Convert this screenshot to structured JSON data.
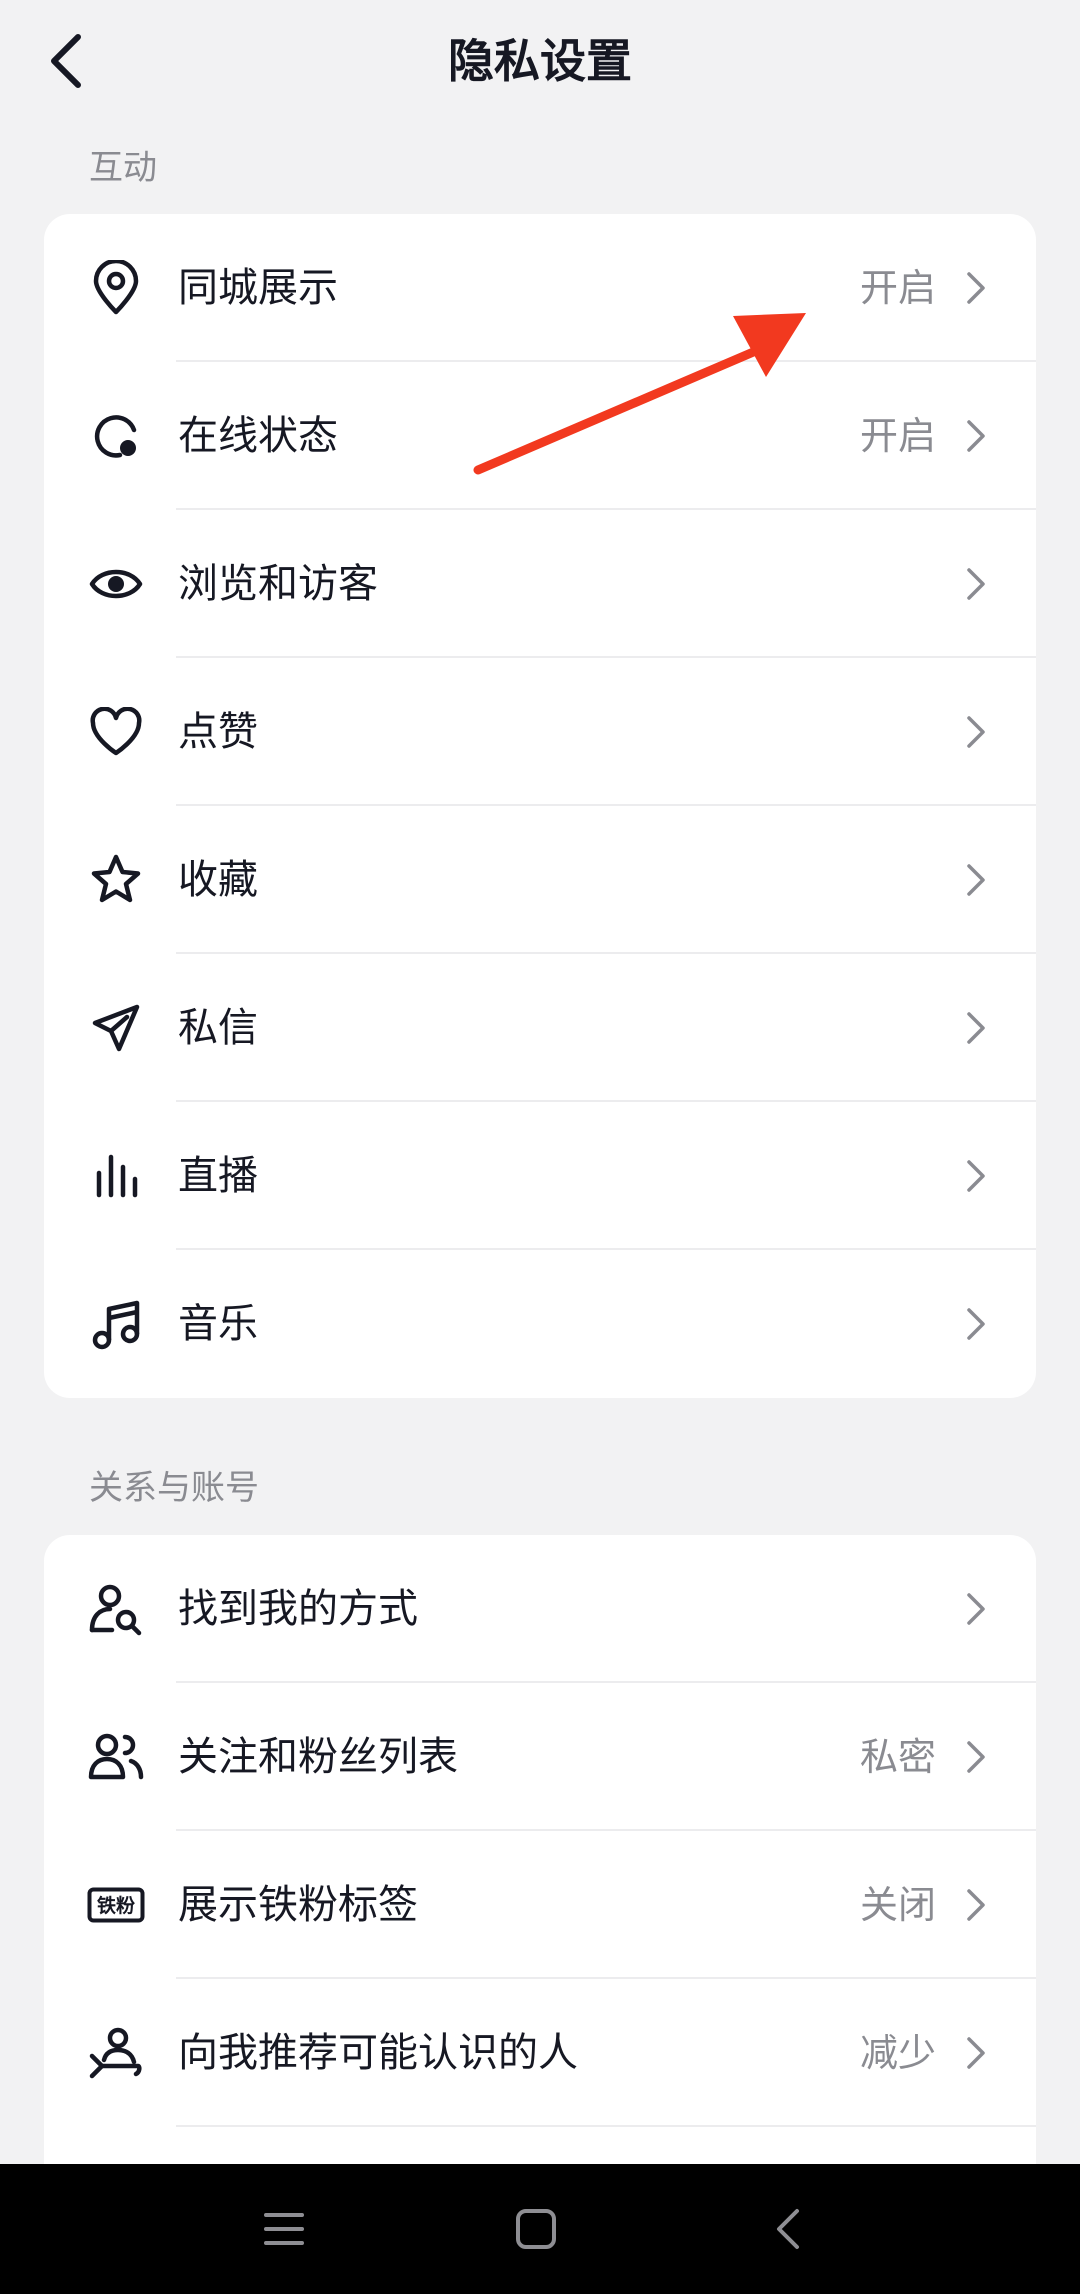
{
  "header": {
    "title": "隐私设置",
    "back_icon": "chevron-left-icon"
  },
  "sections": [
    {
      "label": "互动",
      "items": [
        {
          "label": "同城展示",
          "value": "开启",
          "icon": "location-pin-icon"
        },
        {
          "label": "在线状态",
          "value": "开启",
          "icon": "online-status-icon"
        },
        {
          "label": "浏览和访客",
          "value": "",
          "icon": "eye-icon"
        },
        {
          "label": "点赞",
          "value": "",
          "icon": "heart-icon"
        },
        {
          "label": "收藏",
          "value": "",
          "icon": "star-icon"
        },
        {
          "label": "私信",
          "value": "",
          "icon": "paper-plane-icon"
        },
        {
          "label": "直播",
          "value": "",
          "icon": "live-bars-icon"
        },
        {
          "label": "音乐",
          "value": "",
          "icon": "music-note-icon"
        }
      ]
    },
    {
      "label": "关系与账号",
      "items": [
        {
          "label": "找到我的方式",
          "value": "",
          "icon": "user-search-icon"
        },
        {
          "label": "关注和粉丝列表",
          "value": "私密",
          "icon": "users-icon"
        },
        {
          "label": "展示铁粉标签",
          "value": "关闭",
          "icon": "iron-fan-badge-icon",
          "badge_text": "铁粉"
        },
        {
          "label": "向我推荐可能认识的人",
          "value": "减少",
          "icon": "user-recommend-icon"
        }
      ]
    }
  ],
  "colors": {
    "background": "#f2f2f3",
    "card": "#ffffff",
    "text": "#161823",
    "secondary": "#8a8b91",
    "annotation_arrow": "#f2391f",
    "nav_bar": "#000000"
  },
  "system_nav": {
    "menu_icon": "menu-icon",
    "home_icon": "home-square-icon",
    "back_icon": "back-triangle-icon"
  }
}
